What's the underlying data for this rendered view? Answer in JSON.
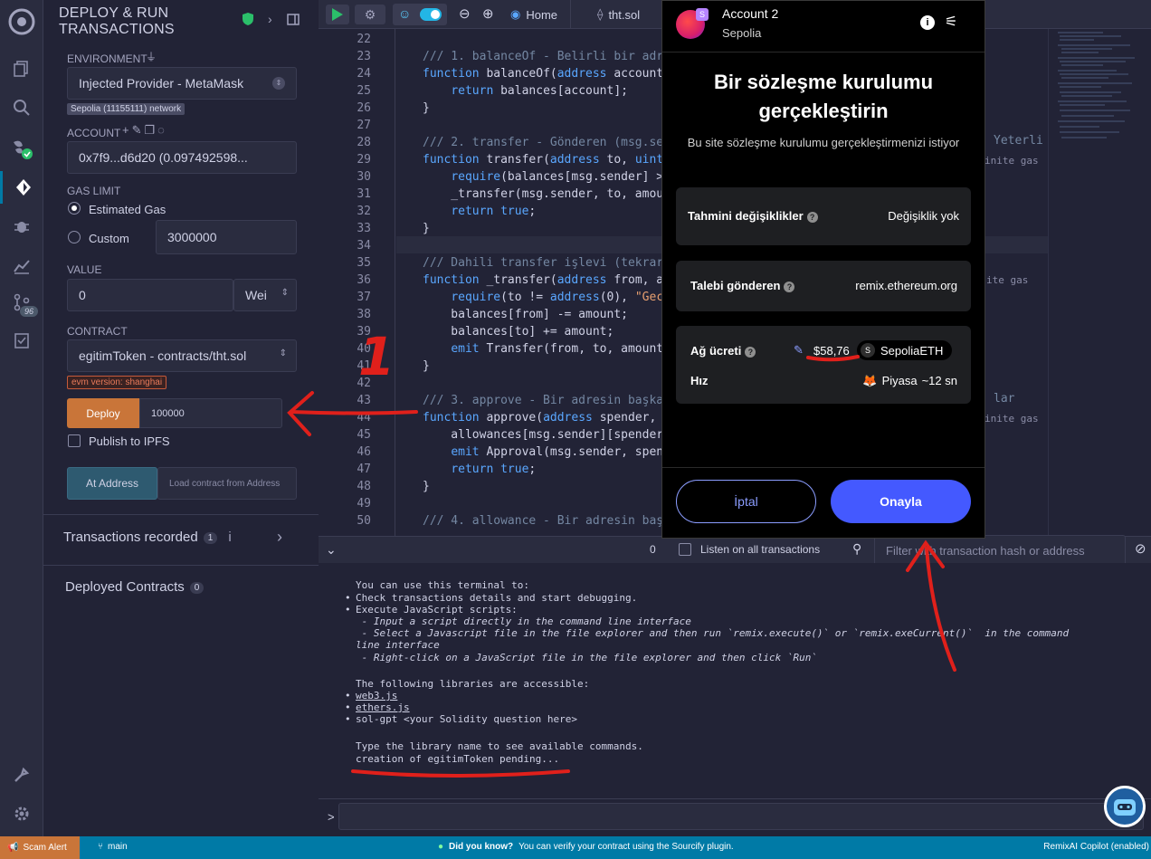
{
  "panel": {
    "title": "DEPLOY & RUN TRANSACTIONS",
    "environment_label": "ENVIRONMENT",
    "environment_value": "Injected Provider - MetaMask",
    "network_chip": "Sepolia (11155111) network",
    "account_label": "ACCOUNT",
    "account_value": "0x7f9...d6d20 (0.097492598...",
    "gas_limit_label": "GAS LIMIT",
    "gas_estimated": "Estimated Gas",
    "gas_custom": "Custom",
    "gas_custom_value": "3000000",
    "value_label": "VALUE",
    "value_amount": "0",
    "value_unit": "Wei",
    "contract_label": "CONTRACT",
    "contract_value": "egitimToken - contracts/tht.sol",
    "evm_chip": "evm version: shanghai",
    "deploy_label": "Deploy",
    "deploy_value": "100000",
    "publish_ipfs": "Publish to IPFS",
    "at_address": "At Address",
    "load_placeholder": "Load contract from Address",
    "tx_recorded": "Transactions recorded",
    "tx_count": "1",
    "deployed": "Deployed Contracts",
    "deployed_count": "0"
  },
  "rail": {
    "badge": "96"
  },
  "topbar": {
    "home": "Home",
    "file": "tht.sol"
  },
  "editor": {
    "lines": [
      {
        "n": "22",
        "html": ""
      },
      {
        "n": "23",
        "html": "<span class='cm'>/// 1. balanceOf - Belirli bir adr</span>"
      },
      {
        "n": "24",
        "html": "<span class='kw'>function</span> balanceOf(<span class='kw'>address</span> account"
      },
      {
        "n": "25",
        "html": "    <span class='kw'>return</span> balances[account];"
      },
      {
        "n": "26",
        "html": "}"
      },
      {
        "n": "27",
        "html": ""
      },
      {
        "n": "28",
        "html": "<span class='cm'>/// 2. transfer - Gönderen (msg.se</span>"
      },
      {
        "n": "29",
        "html": "<span class='kw'>function</span> transfer(<span class='kw'>address</span> to, <span class='kw'>uint</span>"
      },
      {
        "n": "30",
        "html": "    <span class='kw'>require</span>(balances[msg.sender] >"
      },
      {
        "n": "31",
        "html": "    _transfer(msg.sender, to, amou"
      },
      {
        "n": "32",
        "html": "    <span class='kw'>return true</span>;"
      },
      {
        "n": "33",
        "html": "}"
      },
      {
        "n": "34",
        "html": ""
      },
      {
        "n": "35",
        "html": "<span class='cm'>/// Dahili transfer işlevi (tekrar</span>"
      },
      {
        "n": "36",
        "html": "<span class='kw'>function</span> _transfer(<span class='kw'>address</span> from, a"
      },
      {
        "n": "37",
        "html": "    <span class='kw'>require</span>(to != <span class='kw'>address</span>(0), <span class='st'>\"Gec</span>"
      },
      {
        "n": "38",
        "html": "    balances[from] -= amount;"
      },
      {
        "n": "39",
        "html": "    balances[to] += amount;"
      },
      {
        "n": "40",
        "html": "    <span class='kw'>emit</span> Transfer(from, to, amount"
      },
      {
        "n": "41",
        "html": "}"
      },
      {
        "n": "42",
        "html": ""
      },
      {
        "n": "43",
        "html": "<span class='cm'>/// 3. approve - Bir adresin başka</span>"
      },
      {
        "n": "44",
        "html": "<span class='kw'>function</span> approve(<span class='kw'>address</span> spender,"
      },
      {
        "n": "45",
        "html": "    allowances[msg.sender][spender"
      },
      {
        "n": "46",
        "html": "    <span class='kw'>emit</span> Approval(msg.sender, spen"
      },
      {
        "n": "47",
        "html": "    <span class='kw'>return true</span>;"
      },
      {
        "n": "48",
        "html": "}"
      },
      {
        "n": "49",
        "html": ""
      },
      {
        "n": "50",
        "html": "<span class='cm'>/// 4. allowance - Bir adresin baş</span>"
      }
    ],
    "right_comment_28": "Yeterli",
    "right_comment_43": "lar",
    "gas_hint": "inite gas",
    "gas_hint2": "ite gas"
  },
  "terminal": {
    "count": "0",
    "listen": "Listen on all transactions",
    "filter_placeholder": "Filter with transaction hash or address",
    "lines": [
      "You can use this terminal to:",
      "Check transactions details and start debugging.",
      "Execute JavaScript scripts:",
      " - Input a script directly in the command line interface",
      " - Select a Javascript file in the file explorer and then run `remix.execute()` or `remix.exeCurrent()`  in the command",
      "line interface",
      " - Right-click on a JavaScript file in the file explorer and then click `Run`",
      "The following libraries are accessible:",
      "web3.js",
      "ethers.js",
      "sol-gpt <your Solidity question here>",
      "Type the library name to see available commands.",
      "creation of egitimToken pending..."
    ],
    "prompt": ">"
  },
  "status": {
    "scam_alert": "Scam Alert",
    "branch": "main",
    "did_you_know": "Did you know?",
    "tip": "You can verify your contract using the Sourcify plugin.",
    "copilot": "RemixAI Copilot (enabled)"
  },
  "metamask": {
    "account": "Account 2",
    "network": "Sepolia",
    "title": "Bir sözleşme kurulumu gerçekleştirin",
    "subtitle": "Bu site sözleşme kurulumu gerçekleştirmenizi istiyor",
    "est_changes_label": "Tahmini değişiklikler",
    "est_changes_value": "Değişiklik yok",
    "requester_label": "Talebi gönderen",
    "requester_value": "remix.ethereum.org",
    "fee_label": "Ağ ücreti",
    "fee_value": "$58,76",
    "fee_token": "SepoliaETH",
    "token_letter": "S",
    "speed_label": "Hız",
    "speed_value": "Piyasa",
    "speed_time": "~12 sn",
    "cancel": "İptal",
    "confirm": "Onayla"
  },
  "annotation": {
    "number": "1"
  },
  "colors": {
    "accent": "#007aa6",
    "deploy": "#c97539",
    "mm_blue": "#4459ff",
    "annotation_red": "#e0201b"
  }
}
